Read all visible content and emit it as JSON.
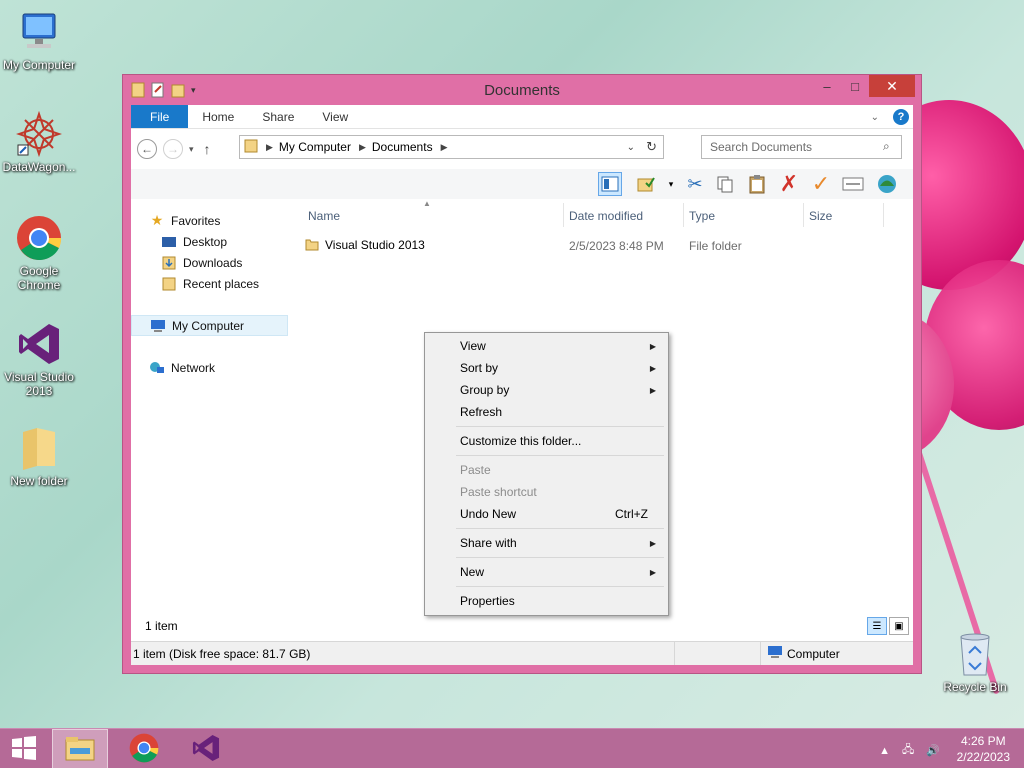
{
  "desktop": {
    "icons": [
      {
        "label": "My Computer",
        "icon": "my-computer-icon"
      },
      {
        "label": "DataWagon...",
        "icon": "datawagon-icon"
      },
      {
        "label": "Google Chrome",
        "icon": "chrome-icon"
      },
      {
        "label": "Visual Studio 2013",
        "icon": "visual-studio-icon"
      },
      {
        "label": "New folder",
        "icon": "folder-icon"
      },
      {
        "label": "Recycle Bin",
        "icon": "recycle-bin-icon"
      }
    ]
  },
  "window": {
    "title": "Documents",
    "controls": {
      "minimize": "–",
      "maximize": "□",
      "close": "✕"
    },
    "ribbon_tabs": [
      "File",
      "Home",
      "Share",
      "View"
    ],
    "help": "?",
    "address": {
      "segments": [
        "My Computer",
        "Documents"
      ]
    },
    "search": {
      "placeholder": "Search Documents"
    },
    "nav": {
      "favorites": "Favorites",
      "desktop": "Desktop",
      "downloads": "Downloads",
      "recent": "Recent places",
      "computer": "My Computer",
      "network": "Network"
    },
    "columns": {
      "name": "Name",
      "date": "Date modified",
      "type": "Type",
      "size": "Size"
    },
    "files": [
      {
        "name": "Visual Studio 2013",
        "date": "2/5/2023 8:48 PM",
        "type": "File folder",
        "size": ""
      }
    ],
    "item_count": "1 item",
    "status": {
      "left": "1 item (Disk free space: 81.7 GB)",
      "right": "Computer"
    }
  },
  "context_menu": {
    "view": "View",
    "sort_by": "Sort by",
    "group_by": "Group by",
    "refresh": "Refresh",
    "customize": "Customize this folder...",
    "paste": "Paste",
    "paste_shortcut": "Paste shortcut",
    "undo_new": "Undo New",
    "undo_shortcut": "Ctrl+Z",
    "share_with": "Share with",
    "new": "New",
    "properties": "Properties"
  },
  "taskbar": {
    "time": "4:26 PM",
    "date": "2/22/2023"
  },
  "colors": {
    "window_frame": "#e06fa6",
    "file_tab": "#1979ca",
    "taskbar": "#b56a97"
  }
}
